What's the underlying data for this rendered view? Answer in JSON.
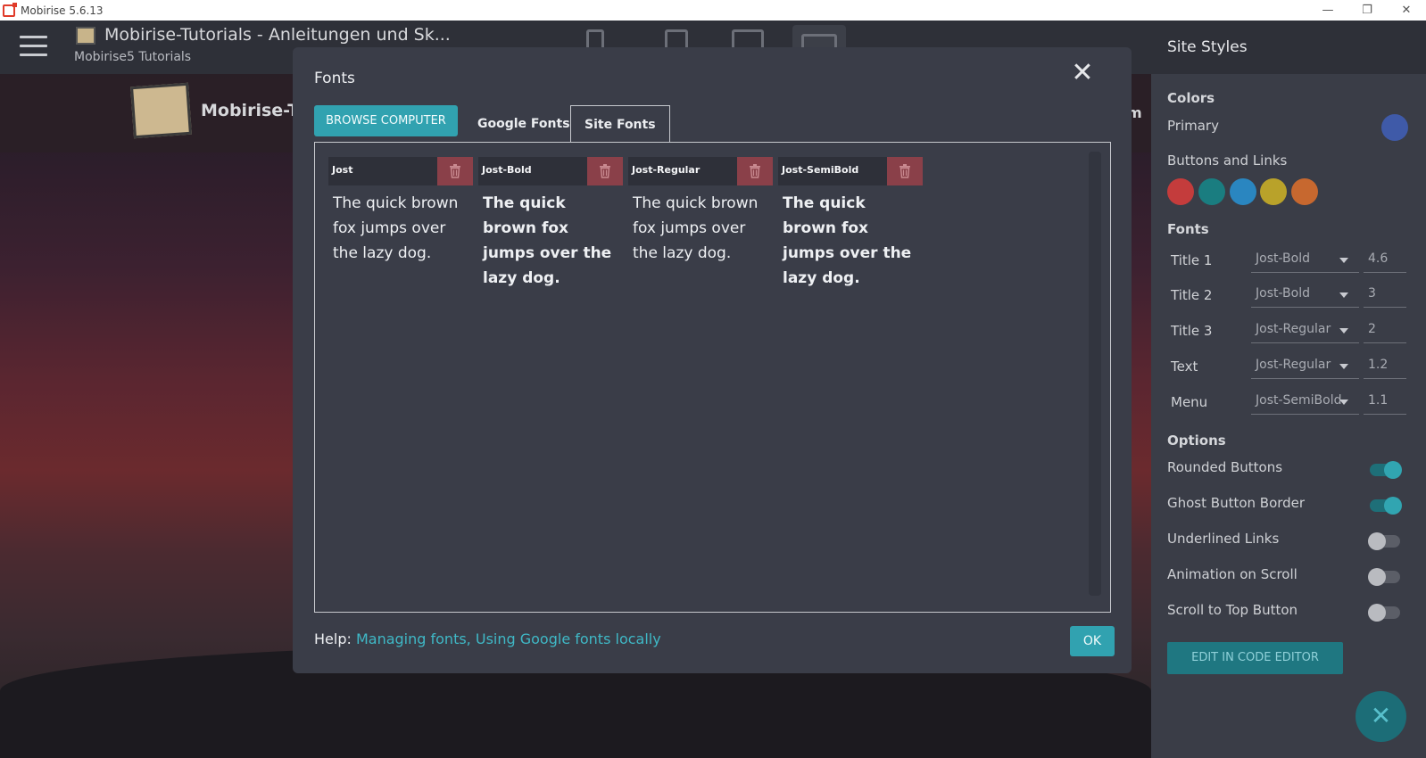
{
  "window": {
    "title": "Mobirise 5.6.13",
    "minimize_glyph": "—",
    "restore_glyph": "❐",
    "close_glyph": "✕"
  },
  "header": {
    "site_title": "Mobirise-Tutorials - Anleitungen und Sk...",
    "site_subtitle": "Mobirise5 Tutorials"
  },
  "preview": {
    "brand": "Mobirise-Tuto",
    "nav_fragment": "m"
  },
  "dialog": {
    "title": "Fonts",
    "close_glyph": "✕",
    "browse_label": "BROWSE COMPUTER",
    "tabs": [
      {
        "label": "Google Fonts",
        "active": false
      },
      {
        "label": "Site Fonts",
        "active": true
      }
    ],
    "font_cards": [
      {
        "name": "Jost",
        "sample": "The quick brown fox jumps over the lazy dog.",
        "bold": false
      },
      {
        "name": "Jost-Bold",
        "sample": "The quick brown fox jumps over the lazy dog.",
        "bold": true
      },
      {
        "name": "Jost-Regular",
        "sample": "The quick brown fox jumps over the lazy dog.",
        "bold": false
      },
      {
        "name": "Jost-SemiBold",
        "sample": "The quick brown fox jumps over the lazy dog.",
        "bold": true
      }
    ],
    "help_label": "Help:",
    "help_link_1": "Managing fonts,",
    "help_link_2": "Using Google fonts locally",
    "ok_label": "OK"
  },
  "panel": {
    "title": "Site Styles",
    "colors_heading": "Colors",
    "primary_label": "Primary",
    "primary_color": "#3f5aa8",
    "buttons_links_label": "Buttons and Links",
    "button_colors": [
      "#c43c3c",
      "#1a7d80",
      "#2a86c0",
      "#b9a22a",
      "#c7682f"
    ],
    "fonts_heading": "Fonts",
    "font_rows": [
      {
        "label": "Title 1",
        "font": "Jost-Bold",
        "size": "4.6"
      },
      {
        "label": "Title 2",
        "font": "Jost-Bold",
        "size": "3"
      },
      {
        "label": "Title 3",
        "font": "Jost-Regular",
        "size": "2"
      },
      {
        "label": "Text",
        "font": "Jost-Regular",
        "size": "1.2"
      },
      {
        "label": "Menu",
        "font": "Jost-SemiBold",
        "size": "1.1"
      }
    ],
    "options_heading": "Options",
    "options": [
      {
        "label": "Rounded Buttons",
        "on": true
      },
      {
        "label": "Ghost Button Border",
        "on": true
      },
      {
        "label": "Underlined Links",
        "on": false
      },
      {
        "label": "Animation on Scroll",
        "on": false
      },
      {
        "label": "Scroll to Top Button",
        "on": false
      }
    ],
    "code_editor_label": "EDIT IN CODE EDITOR",
    "fab_glyph": "✕"
  }
}
